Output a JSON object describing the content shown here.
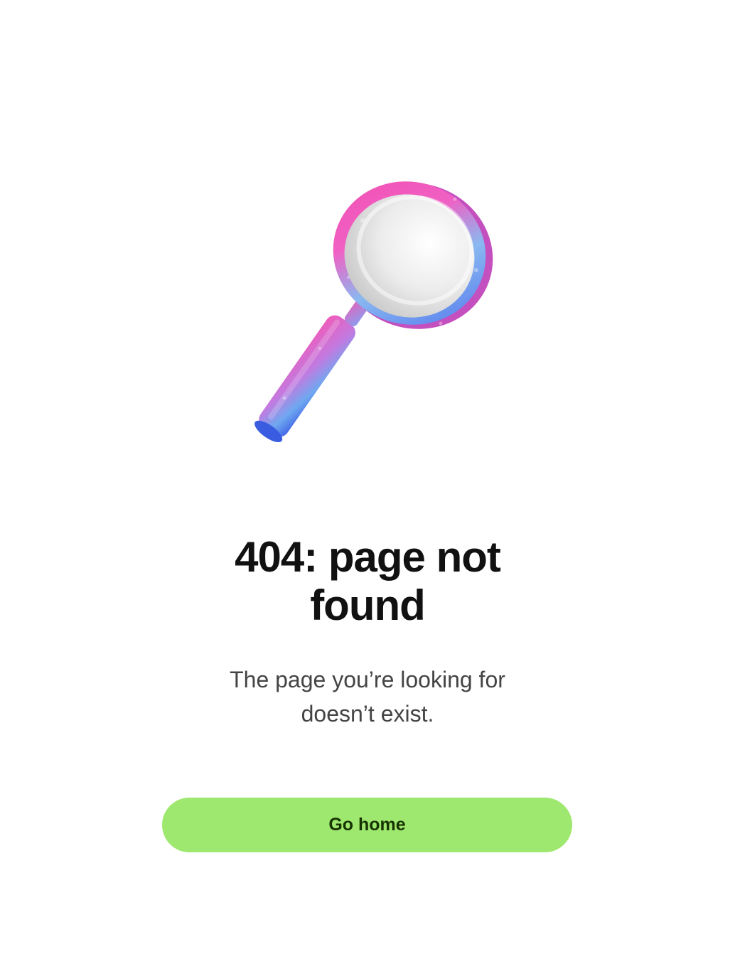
{
  "illustration": {
    "icon": "magnifying-glass-icon",
    "colors": {
      "pink": "#f050b4",
      "blue": "#4a78f0",
      "cyan": "#6ec8ee",
      "lens": "#e8e8e8"
    }
  },
  "error": {
    "title_line1": "404: page not",
    "title_line2": "found",
    "message_line1": "The page you’re looking for",
    "message_line2": "doesn’t exist."
  },
  "actions": {
    "home_label": "Go home",
    "home_color": "#9fe870"
  }
}
